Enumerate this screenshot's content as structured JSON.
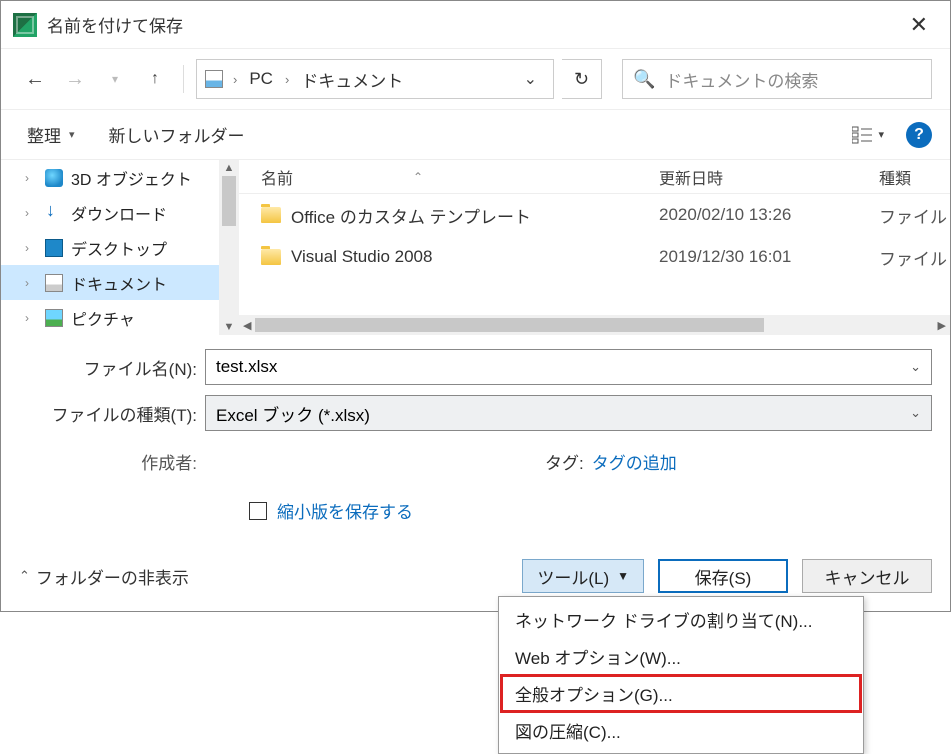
{
  "title": "名前を付けて保存",
  "breadcrumb": {
    "seg1": "PC",
    "seg2": "ドキュメント"
  },
  "search_placeholder": "ドキュメントの検索",
  "toolbar": {
    "organize": "整理",
    "new_folder": "新しいフォルダー"
  },
  "tree": {
    "items": [
      {
        "label": "3D オブジェクト"
      },
      {
        "label": "ダウンロード"
      },
      {
        "label": "デスクトップ"
      },
      {
        "label": "ドキュメント"
      },
      {
        "label": "ピクチャ"
      }
    ]
  },
  "columns": {
    "name": "名前",
    "date": "更新日時",
    "type": "種類"
  },
  "rows": [
    {
      "name": "Office のカスタム テンプレート",
      "date": "2020/02/10 13:26",
      "type": "ファイル"
    },
    {
      "name": "Visual Studio 2008",
      "date": "2019/12/30 16:01",
      "type": "ファイル"
    }
  ],
  "form": {
    "filename_label": "ファイル名(N):",
    "filename_value": "test.xlsx",
    "filetype_label": "ファイルの種類(T):",
    "filetype_value": "Excel ブック (*.xlsx)",
    "author_label": "作成者:",
    "tag_label": "タグ:",
    "tag_link": "タグの追加",
    "thumbnail_label": "縮小版を保存する"
  },
  "footer": {
    "hide_folders": "フォルダーの非表示",
    "tools": "ツール(L)",
    "save": "保存(S)",
    "cancel": "キャンセル"
  },
  "menu": {
    "items": [
      "ネットワーク ドライブの割り当て(N)...",
      "Web オプション(W)...",
      "全般オプション(G)...",
      "図の圧縮(C)..."
    ]
  }
}
